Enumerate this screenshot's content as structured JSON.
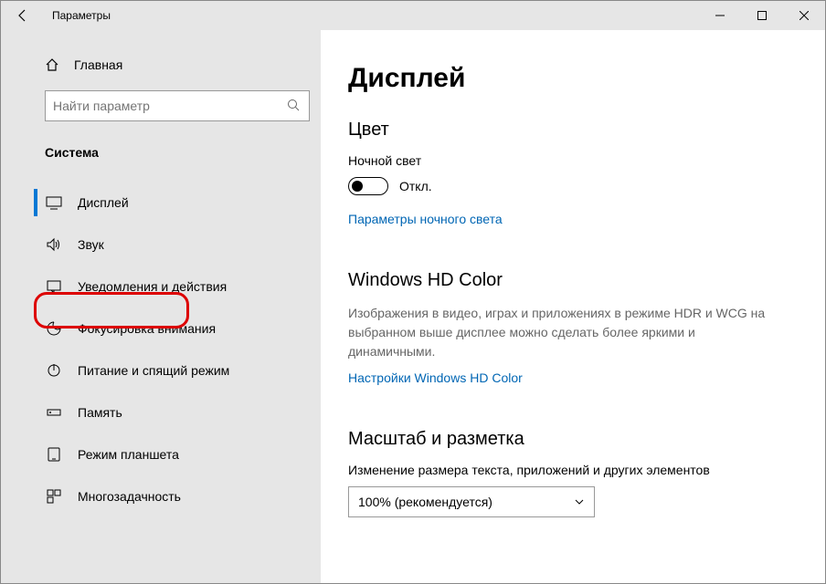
{
  "window": {
    "title": "Параметры"
  },
  "sidebar": {
    "home": "Главная",
    "search_placeholder": "Найти параметр",
    "category": "Система",
    "items": [
      {
        "label": "Дисплей"
      },
      {
        "label": "Звук"
      },
      {
        "label": "Уведомления и действия"
      },
      {
        "label": "Фокусировка внимания"
      },
      {
        "label": "Питание и спящий режим"
      },
      {
        "label": "Память"
      },
      {
        "label": "Режим планшета"
      },
      {
        "label": "Многозадачность"
      }
    ]
  },
  "content": {
    "title": "Дисплей",
    "color": {
      "heading": "Цвет",
      "nightlight_label": "Ночной свет",
      "toggle_state": "Откл.",
      "nightlight_link": "Параметры ночного света"
    },
    "hd": {
      "heading": "Windows HD Color",
      "desc": "Изображения в видео, играх и приложениях в режиме HDR и WCG на выбранном выше дисплее можно сделать более яркими и динамичными.",
      "link": "Настройки Windows HD Color"
    },
    "scale": {
      "heading": "Масштаб и разметка",
      "label": "Изменение размера текста, приложений и других элементов",
      "value": "100% (рекомендуется)"
    }
  }
}
